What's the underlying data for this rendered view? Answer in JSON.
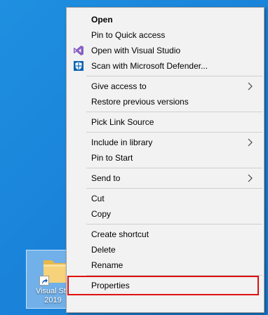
{
  "menu": {
    "items": [
      {
        "label": "Open",
        "bold": true
      },
      {
        "label": "Pin to Quick access"
      },
      {
        "label": "Open with Visual Studio",
        "icon": "visual-studio-icon"
      },
      {
        "label": "Scan with Microsoft Defender...",
        "icon": "defender-shield-icon"
      },
      {
        "label": "Give access to",
        "submenu": true
      },
      {
        "label": "Restore previous versions"
      },
      {
        "label": "Pick Link Source"
      },
      {
        "label": "Include in library",
        "submenu": true
      },
      {
        "label": "Pin to Start"
      },
      {
        "label": "Send to",
        "submenu": true
      },
      {
        "label": "Cut"
      },
      {
        "label": "Copy"
      },
      {
        "label": "Create shortcut"
      },
      {
        "label": "Delete"
      },
      {
        "label": "Rename"
      },
      {
        "label": "Properties"
      }
    ]
  },
  "desktop_icon": {
    "label_line1": "Visual Stu",
    "label_line2": "2019",
    "icon": "folder-shortcut-icon"
  },
  "colors": {
    "desktop_bg": "#1a84da",
    "menu_bg": "#f2f2f2",
    "highlight_border": "#e01010",
    "vs_purple": "#865fc5",
    "defender_blue": "#0a64b4"
  }
}
